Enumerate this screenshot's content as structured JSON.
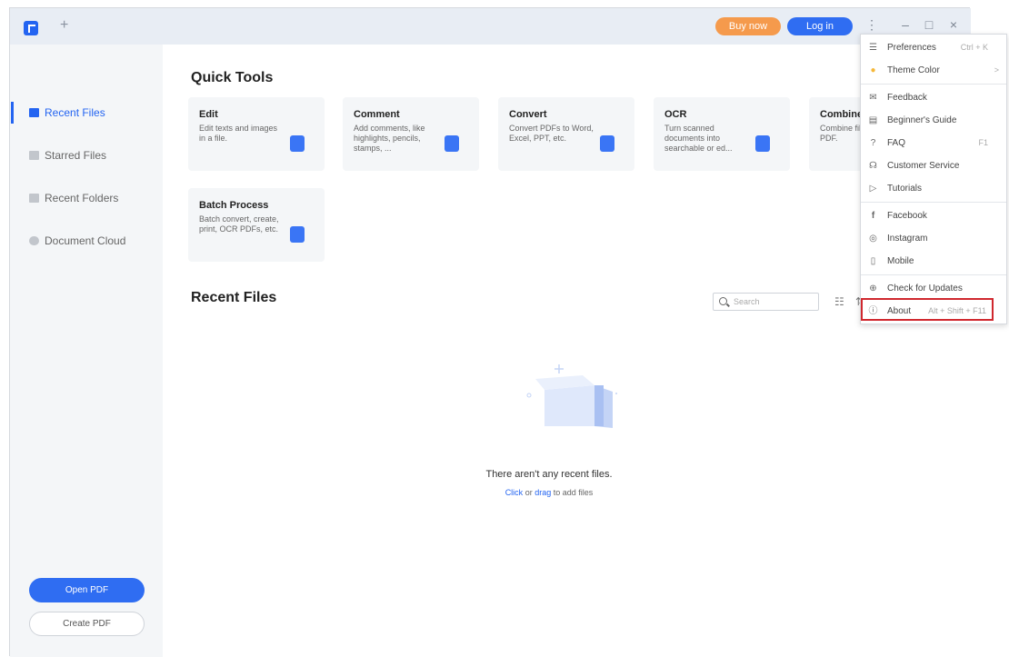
{
  "titlebar": {
    "tab_add": "+",
    "buy_now": "Buy now",
    "log_in": "Log in",
    "kebab": "⋮",
    "minimize": "–",
    "maximize": "□",
    "close": "×"
  },
  "sidebar": {
    "items": [
      {
        "label": "Recent Files",
        "active": true
      },
      {
        "label": "Starred Files",
        "active": false
      },
      {
        "label": "Recent Folders",
        "active": false
      },
      {
        "label": "Document Cloud",
        "active": false
      }
    ],
    "open_pdf": "Open PDF",
    "create_pdf": "Create PDF"
  },
  "quick_tools": {
    "title": "Quick Tools",
    "tools": [
      {
        "name": "Edit",
        "desc": "Edit texts and images in a file."
      },
      {
        "name": "Comment",
        "desc": "Add comments, like highlights, pencils, stamps, ..."
      },
      {
        "name": "Convert",
        "desc": "Convert PDFs to Word, Excel, PPT, etc."
      },
      {
        "name": "OCR",
        "desc": "Turn scanned documents into searchable or ed..."
      },
      {
        "name": "Combine",
        "desc": "Combine files into a PDF."
      },
      {
        "name": "Batch Process",
        "desc": "Batch convert, create, print, OCR PDFs, etc."
      }
    ]
  },
  "recent_files": {
    "title": "Recent Files",
    "search_placeholder": "Search",
    "empty_title": "There aren't any recent files.",
    "empty_click": "Click",
    "empty_or": "or",
    "empty_drag": "drag",
    "empty_rest": "to add files"
  },
  "menu": {
    "items": [
      {
        "label": "Preferences",
        "shortcut": "Ctrl + K",
        "icon": "sliders-icon"
      },
      {
        "label": "Theme Color",
        "shortcut": ">",
        "icon": "theme-dot-icon"
      },
      {
        "label": "Feedback",
        "shortcut": "",
        "icon": "feedback-icon"
      },
      {
        "label": "Beginner's Guide",
        "shortcut": "",
        "icon": "guide-icon"
      },
      {
        "label": "FAQ",
        "shortcut": "F1",
        "icon": "faq-icon"
      },
      {
        "label": "Customer Service",
        "shortcut": "",
        "icon": "headset-icon"
      },
      {
        "label": "Tutorials",
        "shortcut": "",
        "icon": "play-icon"
      },
      {
        "label": "Facebook",
        "shortcut": "",
        "icon": "facebook-icon"
      },
      {
        "label": "Instagram",
        "shortcut": "",
        "icon": "instagram-icon"
      },
      {
        "label": "Mobile",
        "shortcut": "",
        "icon": "mobile-icon"
      },
      {
        "label": "Check for Updates",
        "shortcut": "",
        "icon": "update-icon"
      },
      {
        "label": "About",
        "shortcut": "Alt + Shift + F11",
        "icon": "info-icon"
      }
    ]
  },
  "colors": {
    "accent": "#2364f1",
    "buy_now": "#f59a4c",
    "highlight": "#d0282e"
  }
}
